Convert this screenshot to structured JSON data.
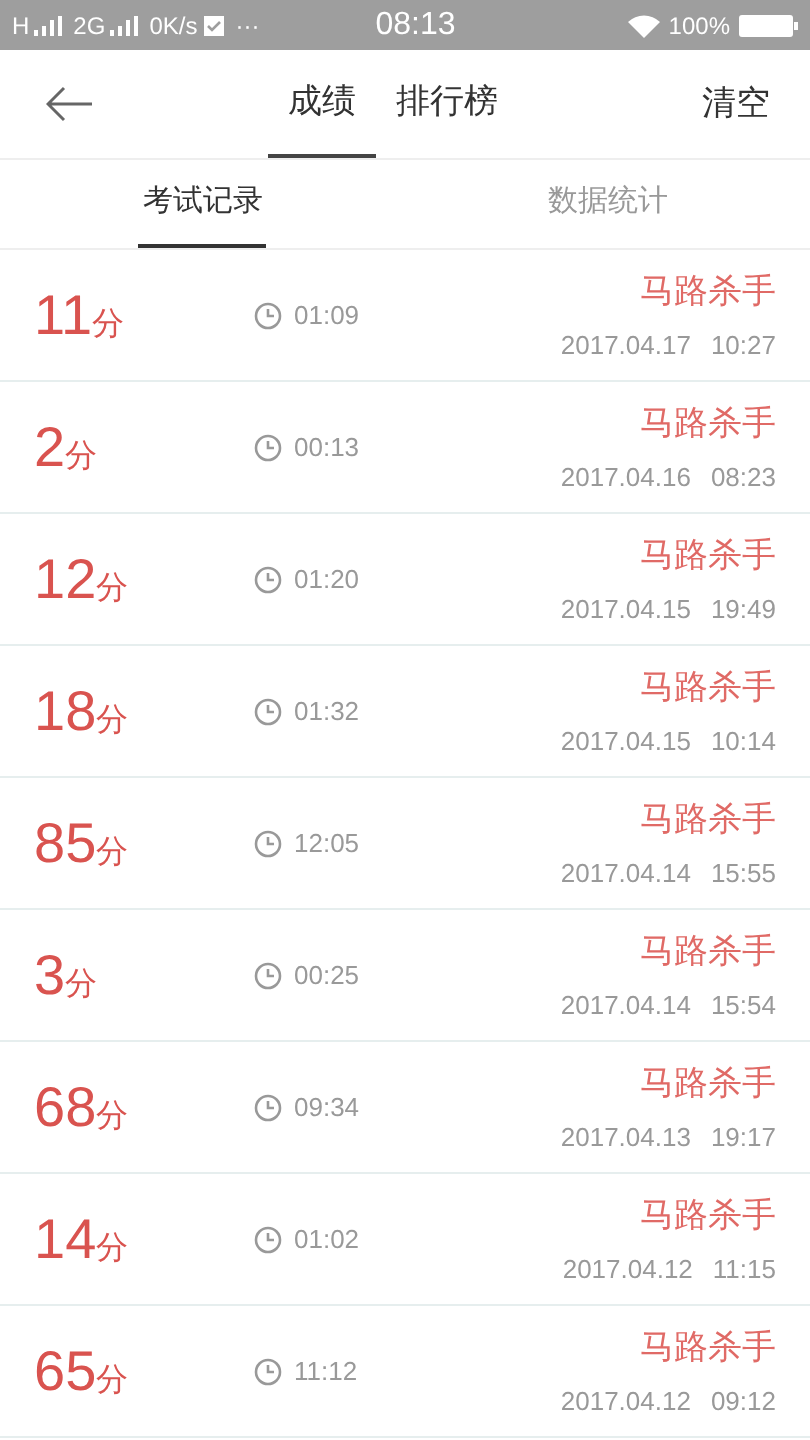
{
  "status_bar": {
    "network_1": "H",
    "network_2": "2G",
    "speed": "0K/s",
    "more": "···",
    "time": "08:13",
    "battery": "100%"
  },
  "header": {
    "tabs": [
      {
        "label": "成绩",
        "selected": true
      },
      {
        "label": "排行榜",
        "selected": false
      }
    ],
    "action": "清空"
  },
  "sub_tabs": [
    {
      "label": "考试记录",
      "selected": true
    },
    {
      "label": "数据统计",
      "selected": false
    }
  ],
  "records": [
    {
      "score": "11",
      "unit": "分",
      "duration": "01:09",
      "title": "马路杀手",
      "date": "2017.04.17",
      "time": "10:27"
    },
    {
      "score": "2",
      "unit": "分",
      "duration": "00:13",
      "title": "马路杀手",
      "date": "2017.04.16",
      "time": "08:23"
    },
    {
      "score": "12",
      "unit": "分",
      "duration": "01:20",
      "title": "马路杀手",
      "date": "2017.04.15",
      "time": "19:49"
    },
    {
      "score": "18",
      "unit": "分",
      "duration": "01:32",
      "title": "马路杀手",
      "date": "2017.04.15",
      "time": "10:14"
    },
    {
      "score": "85",
      "unit": "分",
      "duration": "12:05",
      "title": "马路杀手",
      "date": "2017.04.14",
      "time": "15:55"
    },
    {
      "score": "3",
      "unit": "分",
      "duration": "00:25",
      "title": "马路杀手",
      "date": "2017.04.14",
      "time": "15:54"
    },
    {
      "score": "68",
      "unit": "分",
      "duration": "09:34",
      "title": "马路杀手",
      "date": "2017.04.13",
      "time": "19:17"
    },
    {
      "score": "14",
      "unit": "分",
      "duration": "01:02",
      "title": "马路杀手",
      "date": "2017.04.12",
      "time": "11:15"
    },
    {
      "score": "65",
      "unit": "分",
      "duration": "11:12",
      "title": "马路杀手",
      "date": "2017.04.12",
      "time": "09:12"
    }
  ]
}
